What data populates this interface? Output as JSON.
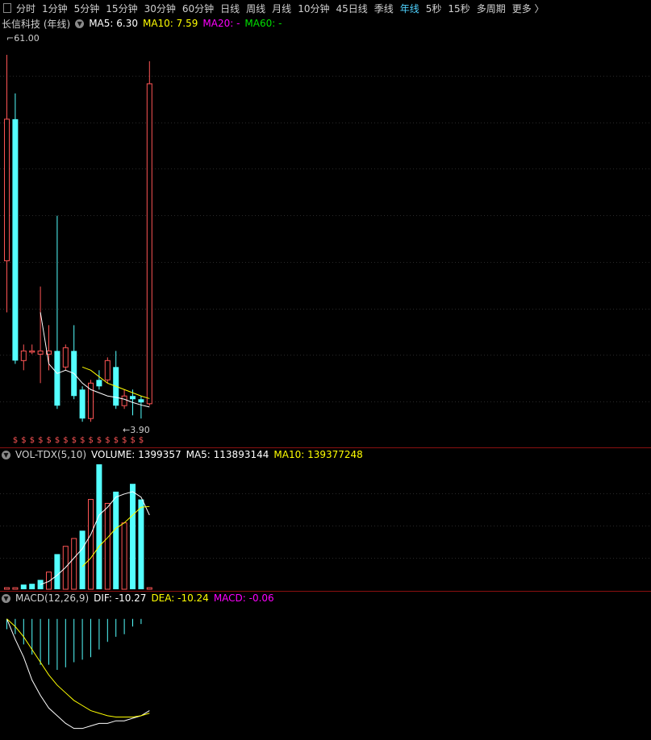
{
  "toolbar": {
    "items": [
      "分时",
      "1分钟",
      "5分钟",
      "15分钟",
      "30分钟",
      "60分钟",
      "日线",
      "周线",
      "月线",
      "10分钟",
      "45日线",
      "季线",
      "年线",
      "5秒",
      "15秒",
      "多周期",
      "更多 〉"
    ],
    "active": "年线"
  },
  "main_header": {
    "title": "长信科技 (年线)",
    "ma5": "MA5: 6.30",
    "ma10": "MA10: 7.59",
    "ma20": "MA20: -",
    "ma60": "MA60: -"
  },
  "price_labels": {
    "high": "61.00",
    "low": "3.90"
  },
  "dollar_marker": "$",
  "vol_header": {
    "name": "VOL-TDX(5,10)",
    "volume": "VOLUME: 1399357",
    "ma5": "MA5: 113893144",
    "ma10": "MA10: 139377248"
  },
  "macd_header": {
    "name": "MACD(12,26,9)",
    "dif": "DIF: -10.27",
    "dea": "DEA: -10.24",
    "macd": "MACD: -0.06"
  },
  "colors": {
    "up": "#ff5555",
    "down": "#54ffff",
    "ma5": "#ffffff",
    "ma10": "#ffff00",
    "ma20": "#ff00ff",
    "ma60": "#00e000",
    "active_tab": "#4fd2ff"
  },
  "chart_data": {
    "type": "candlestick",
    "title": "长信科技 (年线)",
    "price_high_label": 61.0,
    "price_low_label": 3.9,
    "candles": [
      {
        "open": 29.0,
        "close": 51.0,
        "high": 61.0,
        "low": 21.0,
        "dir": "up"
      },
      {
        "open": 51.0,
        "close": 13.5,
        "high": 55.0,
        "low": 13.0,
        "dir": "down"
      },
      {
        "open": 13.5,
        "close": 15.0,
        "high": 16.0,
        "low": 12.0,
        "dir": "up"
      },
      {
        "open": 15.0,
        "close": 15.0,
        "high": 16.0,
        "low": 14.5,
        "dir": "up"
      },
      {
        "open": 14.5,
        "close": 15.0,
        "high": 25.0,
        "low": 10.0,
        "dir": "up"
      },
      {
        "open": 15.0,
        "close": 14.5,
        "high": 19.0,
        "low": 12.0,
        "dir": "up"
      },
      {
        "open": 15.0,
        "close": 6.5,
        "high": 36.0,
        "low": 6.0,
        "dir": "down"
      },
      {
        "open": 12.5,
        "close": 15.5,
        "high": 16.0,
        "low": 12.0,
        "dir": "up"
      },
      {
        "open": 15.0,
        "close": 8.0,
        "high": 19.0,
        "low": 7.5,
        "dir": "down"
      },
      {
        "open": 9.0,
        "close": 4.5,
        "high": 9.5,
        "low": 4.0,
        "dir": "down"
      },
      {
        "open": 4.5,
        "close": 10.0,
        "high": 10.5,
        "low": 4.0,
        "dir": "up"
      },
      {
        "open": 10.5,
        "close": 9.5,
        "high": 12.0,
        "low": 9.0,
        "dir": "down"
      },
      {
        "open": 10.5,
        "close": 13.5,
        "high": 14.0,
        "low": 10.0,
        "dir": "up"
      },
      {
        "open": 12.5,
        "close": 6.5,
        "high": 15.0,
        "low": 6.0,
        "dir": "down"
      },
      {
        "open": 6.5,
        "close": 8.0,
        "high": 9.0,
        "low": 6.0,
        "dir": "up"
      },
      {
        "open": 8.0,
        "close": 7.5,
        "high": 9.0,
        "low": 5.0,
        "dir": "down"
      },
      {
        "open": 7.5,
        "close": 7.0,
        "high": 8.0,
        "low": 4.5,
        "dir": "down"
      },
      {
        "open": 6.8,
        "close": 56.5,
        "high": 60.0,
        "low": 6.5,
        "dir": "up"
      }
    ],
    "ma5": [
      null,
      null,
      null,
      null,
      21.0,
      13.0,
      11.5,
      12.0,
      11.5,
      10.0,
      9.0,
      8.5,
      8.0,
      7.8,
      7.5,
      7.0,
      6.6,
      6.3
    ],
    "ma10": [
      null,
      null,
      null,
      null,
      null,
      null,
      null,
      null,
      null,
      12.5,
      12.0,
      11.0,
      10.0,
      9.5,
      9.0,
      8.5,
      8.0,
      7.6
    ],
    "volume": {
      "ylim": [
        0,
        160000000
      ],
      "values": [
        2000000,
        2000000,
        6000000,
        7000000,
        12000000,
        22000000,
        45000000,
        55000000,
        65000000,
        75000000,
        115000000,
        160000000,
        110000000,
        125000000,
        85000000,
        135000000,
        115000000,
        2000000
      ],
      "dirs": [
        "up",
        "up",
        "down",
        "down",
        "down",
        "up",
        "down",
        "up",
        "up",
        "down",
        "up",
        "down",
        "up",
        "down",
        "up",
        "down",
        "down",
        "up"
      ],
      "ma5": [
        null,
        null,
        null,
        null,
        6000000,
        10000000,
        18000000,
        28000000,
        40000000,
        52000000,
        70000000,
        95000000,
        105000000,
        118000000,
        122000000,
        125000000,
        118000000,
        95000000
      ],
      "ma10": [
        null,
        null,
        null,
        null,
        null,
        null,
        null,
        null,
        null,
        29000000,
        40000000,
        55000000,
        66000000,
        78000000,
        85000000,
        95000000,
        105000000,
        106000000
      ]
    },
    "macd": {
      "ylim": [
        -45,
        5
      ],
      "bars": [
        -4,
        -6,
        -10,
        -14,
        -18,
        -18,
        -20,
        -19,
        -17,
        -16,
        -15,
        -12,
        -9,
        -7,
        -6,
        -3,
        -2,
        0
      ],
      "dif": [
        0,
        -8,
        -15,
        -24,
        -30,
        -35,
        -38,
        -41,
        -43,
        -43,
        -42,
        -41,
        -41,
        -40,
        -40,
        -39,
        -38,
        -36
      ],
      "dea": [
        0,
        -3,
        -7,
        -12,
        -17,
        -22,
        -26,
        -29,
        -32,
        -34,
        -36,
        -37,
        -38,
        -38.5,
        -38.5,
        -38.5,
        -38,
        -37
      ]
    }
  }
}
